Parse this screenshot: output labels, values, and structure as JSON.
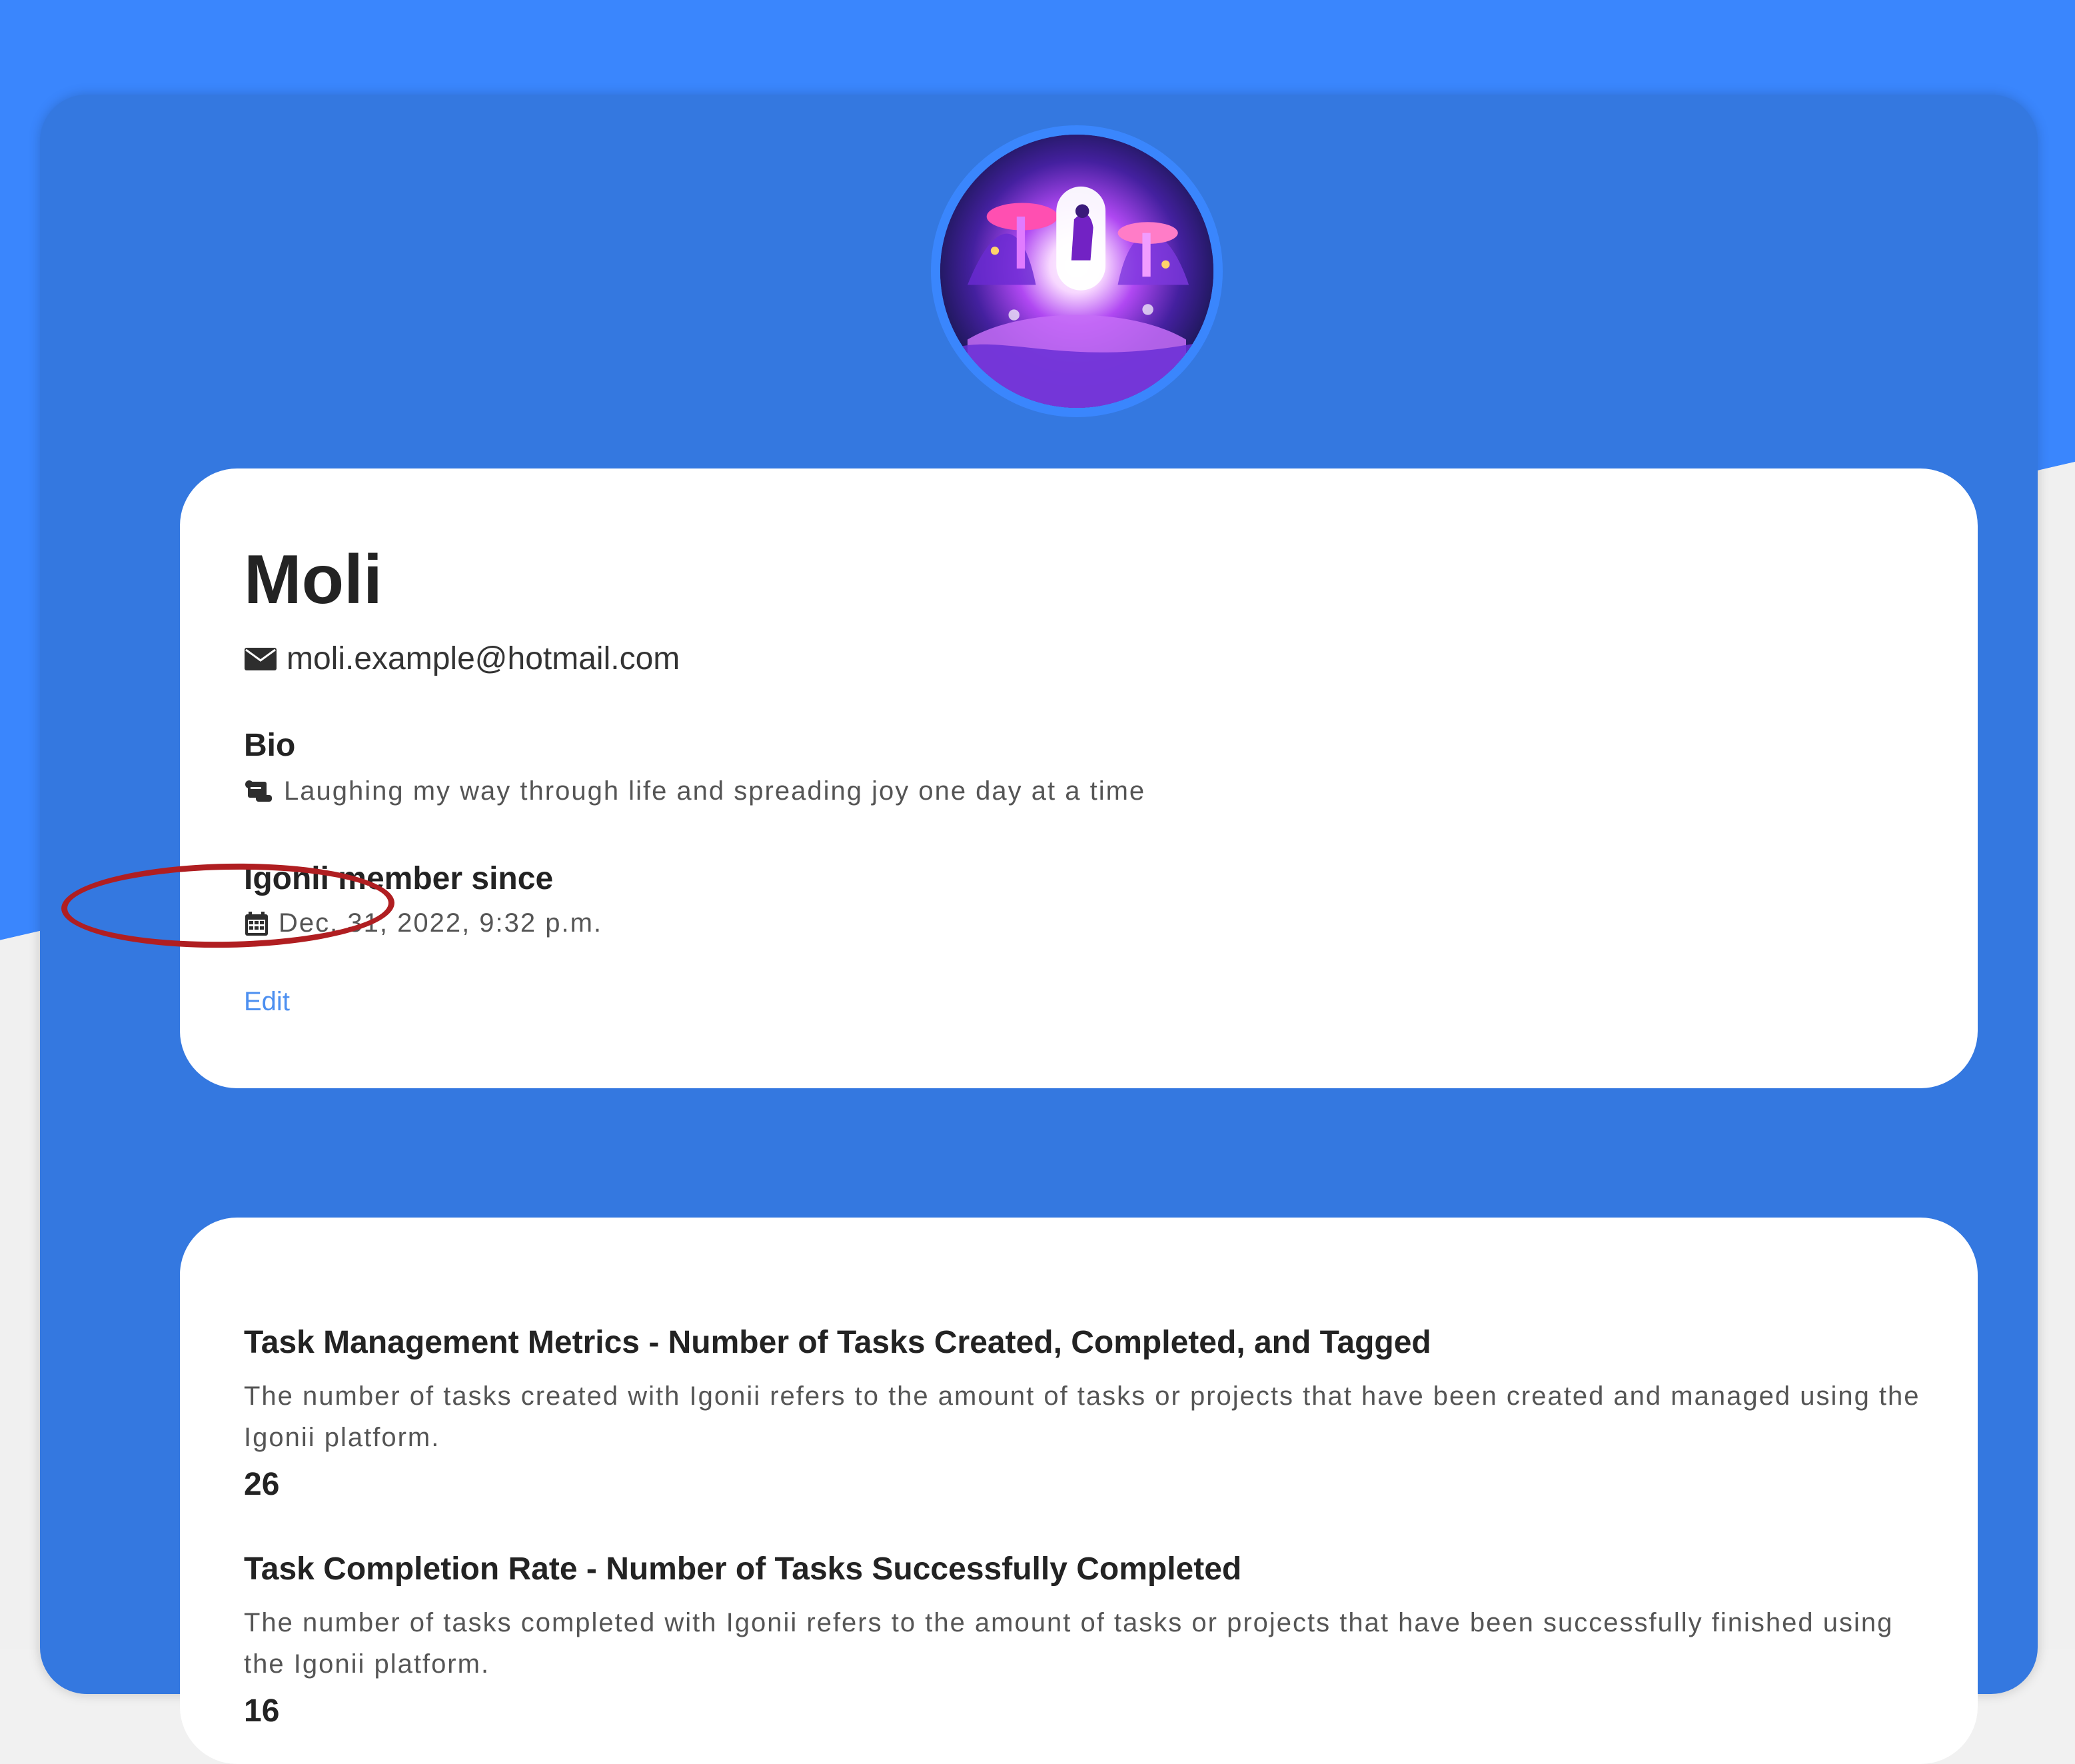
{
  "user": {
    "name": "Moli",
    "email": "moli.example@hotmail.com",
    "bio_label": "Bio",
    "bio": "Laughing my way through life and spreading joy one day at a time",
    "member_label": "Igonii member since",
    "member_since": "Dec. 31, 2022, 9:32 p.m.",
    "edit_label": "Edit"
  },
  "metrics": [
    {
      "title": "Task Management Metrics - Number of Tasks Created, Completed, and Tagged",
      "description": "The number of tasks created with Igonii refers to the amount of tasks or projects that have been created and managed using the Igonii platform.",
      "value": "26"
    },
    {
      "title": "Task Completion Rate - Number of Tasks Successfully Completed",
      "description": "The number of tasks completed with Igonii refers to the amount of tasks or projects that have been successfully finished using the Igonii platform.",
      "value": "16"
    }
  ],
  "colors": {
    "page_blue": "#3a86fd",
    "profile_blue": "#3478e0",
    "card": "#ffffff",
    "link": "#4c8ff0",
    "highlight_ring": "#b01e21"
  },
  "icons": {
    "email": "envelope-icon",
    "bio": "scroll-icon",
    "member_since": "calendar-icon"
  }
}
